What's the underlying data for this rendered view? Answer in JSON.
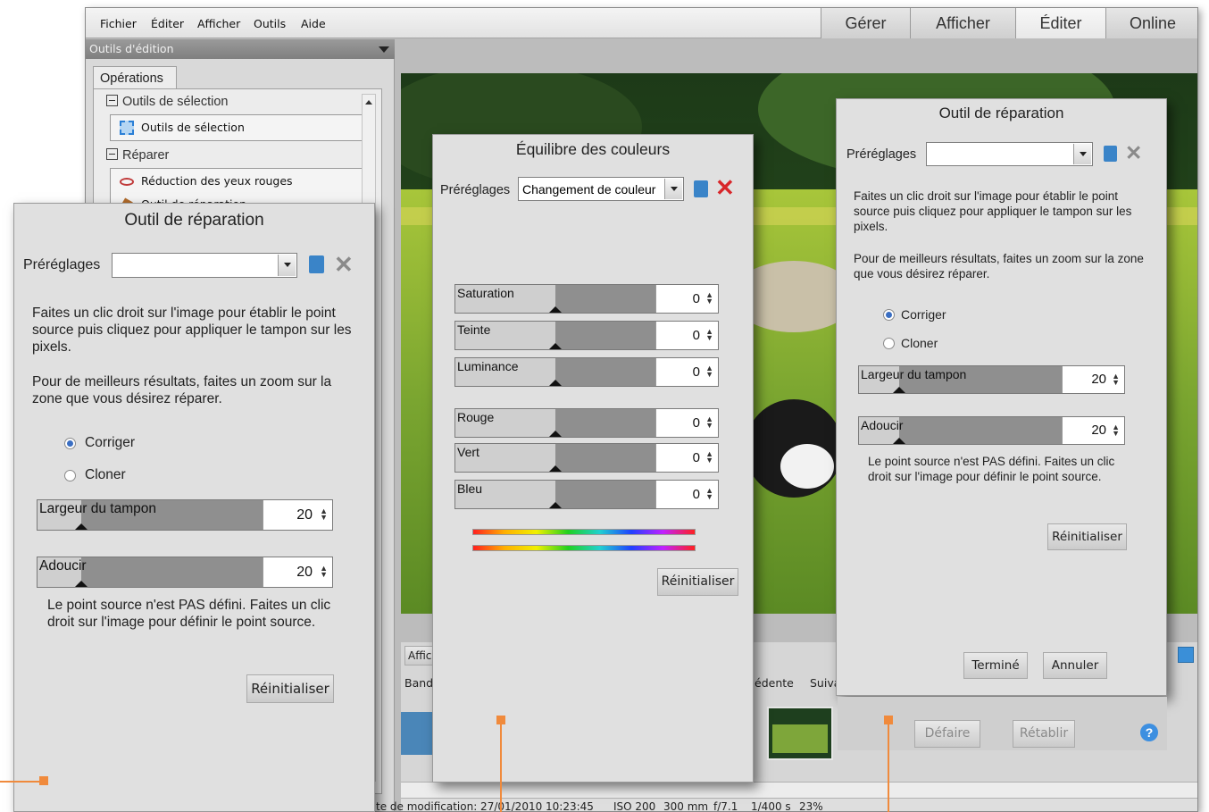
{
  "menu": {
    "items": [
      "Fichier",
      "Éditer",
      "Afficher",
      "Outils",
      "Aide"
    ],
    "mode_tabs": [
      "Gérer",
      "Afficher",
      "Éditer",
      "Online"
    ],
    "active_mode": "Éditer"
  },
  "left_panel": {
    "header": "Outils d'édition",
    "tab": "Opérations",
    "sections": [
      {
        "label": "Outils de sélection",
        "items": [
          "Outils de sélection"
        ]
      },
      {
        "label": "Réparer",
        "items": [
          "Réduction des yeux rouges",
          "Outil de réparation"
        ]
      }
    ]
  },
  "strip": {
    "view_button": "Affic",
    "band_label": "Band",
    "prev_label": "édente",
    "next_label": "Suiva"
  },
  "status_bar": {
    "date": "te de modification: 27/01/2010 10:23:45",
    "iso": "ISO 200",
    "focal": "300 mm",
    "aperture": "f/7.1",
    "shutter": "1/400 s",
    "zoom": "23%"
  },
  "repair_dialog_left": {
    "title": "Outil de réparation",
    "presets_label": "Préréglages",
    "presets_value": "",
    "instructions": "Faites un clic droit sur l'image pour établir le point source puis cliquez pour appliquer le tampon sur les pixels.",
    "zoom_tip": "Pour de meilleurs résultats, faites un zoom sur la zone que vous désirez réparer.",
    "radio_correct": "Corriger",
    "radio_clone": "Cloner",
    "stamp_width_label": "Largeur du tampon",
    "stamp_width_value": "20",
    "soften_label": "Adoucir",
    "soften_value": "20",
    "source_warning": "Le point source n'est PAS défini.  Faites un clic droit sur l'image pour définir le point source.",
    "reset_button": "Réinitialiser"
  },
  "color_balance_dialog": {
    "title": "Équilibre des couleurs",
    "presets_label": "Préréglages",
    "presets_value": "Changement de couleur",
    "sliders": [
      {
        "label": "Saturation",
        "value": "0"
      },
      {
        "label": "Teinte",
        "value": "0"
      },
      {
        "label": "Luminance",
        "value": "0"
      },
      {
        "label": "Rouge",
        "value": "0"
      },
      {
        "label": "Vert",
        "value": "0"
      },
      {
        "label": "Bleu",
        "value": "0"
      }
    ],
    "reset_button": "Réinitialiser"
  },
  "repair_dialog_right": {
    "title": "Outil de réparation",
    "presets_label": "Préréglages",
    "presets_value": "",
    "instructions": "Faites un clic droit sur l'image pour établir le point source puis cliquez pour appliquer le tampon sur les pixels.",
    "zoom_tip": "Pour de meilleurs résultats, faites un zoom sur la zone que vous désirez réparer.",
    "radio_correct": "Corriger",
    "radio_clone": "Cloner",
    "stamp_width_label": "Largeur du tampon",
    "stamp_width_value": "20",
    "soften_label": "Adoucir",
    "soften_value": "20",
    "source_warning": "Le point source n'est PAS défini.  Faites un clic droit sur l'image pour définir le point source.",
    "reset_button": "Réinitialiser",
    "done_button": "Terminé",
    "cancel_button": "Annuler",
    "undo_button": "Défaire",
    "redo_button": "Rétablir"
  },
  "colors": {
    "callout": "#f08a3c",
    "delete_red": "#d8262a",
    "help_blue": "#3d8fe0"
  }
}
